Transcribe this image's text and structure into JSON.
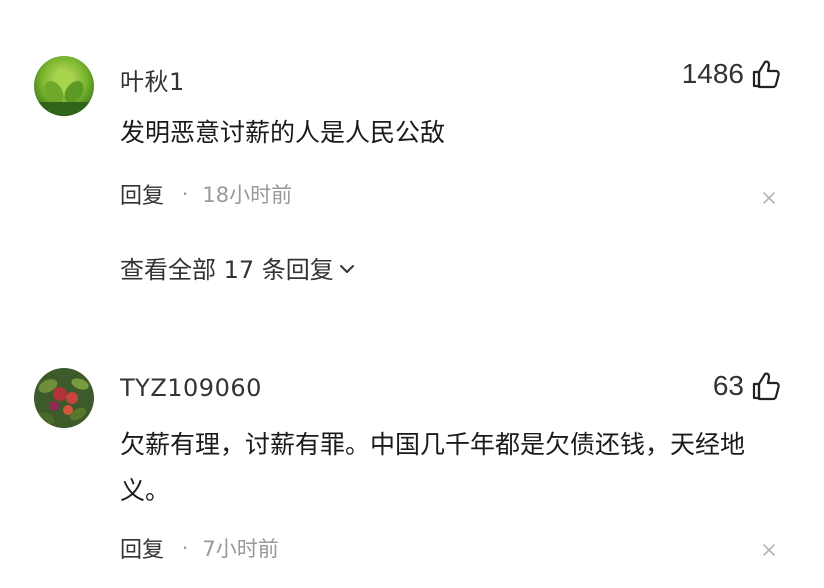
{
  "comments": [
    {
      "username": "叶秋1",
      "likes": "1486",
      "text": "发明恶意讨薪的人是人民公敌",
      "reply_label": "回复",
      "separator": "·",
      "time": "18小时前",
      "view_all": "查看全部 17 条回复",
      "avatar_icon": "tea-leaf-avatar",
      "like_icon": "thumbs-up-icon",
      "close_icon": "close-icon"
    },
    {
      "username": "TYZ109060",
      "likes": "63",
      "text": "欠薪有理，讨薪有罪。中国几千年都是欠债还钱，天经地义。",
      "reply_label": "回复",
      "separator": "·",
      "time": "7小时前",
      "avatar_icon": "flower-avatar",
      "like_icon": "thumbs-up-icon",
      "close_icon": "close-icon"
    }
  ],
  "colors": {
    "text": "#1a1a1a",
    "meta": "#999999",
    "background": "#ffffff"
  }
}
